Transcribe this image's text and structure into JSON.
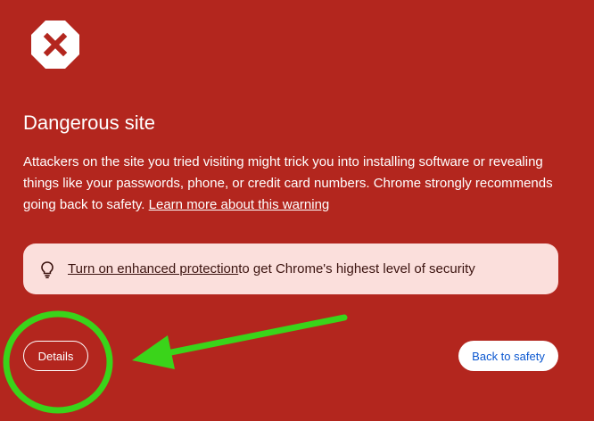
{
  "icons": {
    "warning": "octagon-x-icon",
    "bulb": "lightbulb-icon"
  },
  "colors": {
    "background": "#b3261e",
    "panel": "#fbdfdc",
    "accent_text": "#0b57d0",
    "annotation": "#3ad41a"
  },
  "interstitial": {
    "title": "Dangerous site",
    "body_text": "Attackers on the site you tried visiting might trick you into installing software or revealing things like your passwords, phone, or credit card numbers. Chrome strongly recommends going back to safety.",
    "learn_more_link": "Learn more about this warning"
  },
  "enhanced_protection": {
    "link_text": "Turn on enhanced protection",
    "trailing_text": " to get Chrome's highest level of security"
  },
  "buttons": {
    "details_label": "Details",
    "back_to_safety_label": "Back to safety"
  }
}
